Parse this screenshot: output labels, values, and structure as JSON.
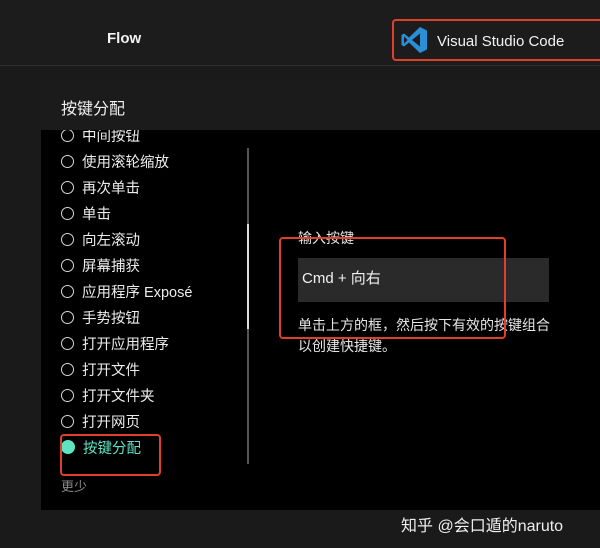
{
  "topbar": {
    "tab_label": "Flow",
    "app_name": "Visual Studio Code",
    "app_icon": "vscode-logo-icon",
    "brand_color": "#2b8fd8",
    "highlight_color": "#e0402a"
  },
  "panel": {
    "title": "按键分配",
    "actions": [
      {
        "label": "中间按钮",
        "selected": false
      },
      {
        "label": "使用滚轮缩放",
        "selected": false
      },
      {
        "label": "再次单击",
        "selected": false
      },
      {
        "label": "单击",
        "selected": false
      },
      {
        "label": "向左滚动",
        "selected": false
      },
      {
        "label": "屏幕捕获",
        "selected": false
      },
      {
        "label": "应用程序 Exposé",
        "selected": false
      },
      {
        "label": "手势按钮",
        "selected": false
      },
      {
        "label": "打开应用程序",
        "selected": false
      },
      {
        "label": "打开文件",
        "selected": false
      },
      {
        "label": "打开文件夹",
        "selected": false
      },
      {
        "label": "打开网页",
        "selected": false
      },
      {
        "label": "按键分配",
        "selected": true
      }
    ],
    "less_label": "更少",
    "accent_color": "#5fe3c3",
    "keystroke": {
      "label": "输入按键",
      "value": "Cmd + 向右",
      "hint": "单击上方的框，然后按下有效的按键组合以创建快捷键。"
    }
  },
  "watermark": "知乎 @会口遁的naruto"
}
